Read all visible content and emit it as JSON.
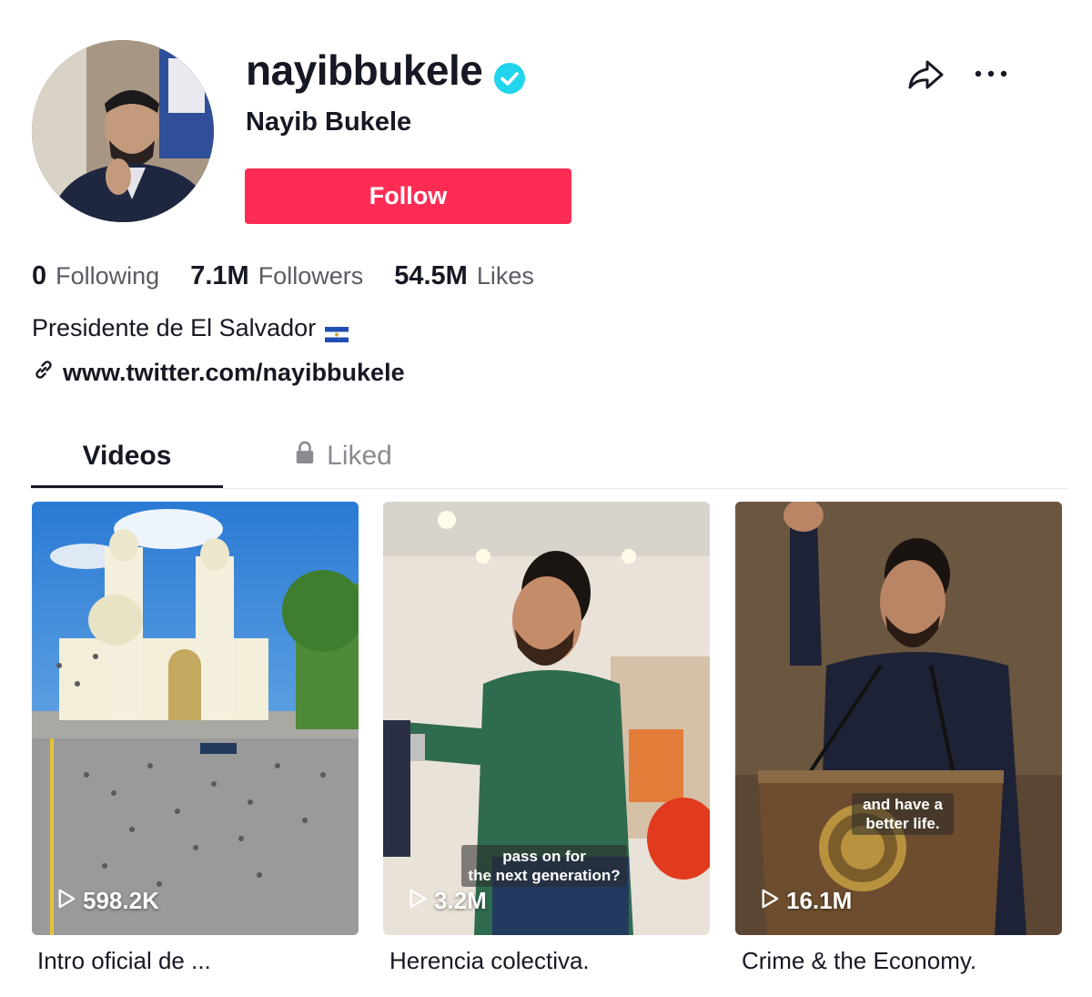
{
  "profile": {
    "username": "nayibbukele",
    "display_name": "Nayib Bukele",
    "follow_label": "Follow",
    "verified": true,
    "bio": "Presidente de El Salvador",
    "link": "www.twitter.com/nayibbukele"
  },
  "stats": [
    {
      "value": "0",
      "label": "Following"
    },
    {
      "value": "7.1M",
      "label": "Followers"
    },
    {
      "value": "54.5M",
      "label": "Likes"
    }
  ],
  "tabs": [
    {
      "label": "Videos",
      "active": true
    },
    {
      "label": "Liked",
      "locked": true
    }
  ],
  "videos": [
    {
      "views": "598.2K",
      "title": "Intro oficial de ...",
      "overlay_text": ""
    },
    {
      "views": "3.2M",
      "title": "Herencia colectiva.",
      "overlay_text": "pass on for the next generation?"
    },
    {
      "views": "16.1M",
      "title": "Crime & the Economy.",
      "overlay_text": "and have a better life."
    }
  ],
  "video_overlays": {
    "v2_line1": "pass on for",
    "v2_line2": "the next generation?",
    "v3_line1": "and have a",
    "v3_line2": "better life."
  },
  "colors": {
    "follow_button": "#fe2c55",
    "verified_badge": "#20d5ec",
    "text_primary": "#161823",
    "text_secondary": "#5a5b63"
  },
  "icons": [
    "verified-icon",
    "share-icon",
    "more-icon",
    "flag-icon",
    "link-icon",
    "lock-icon",
    "play-icon"
  ]
}
